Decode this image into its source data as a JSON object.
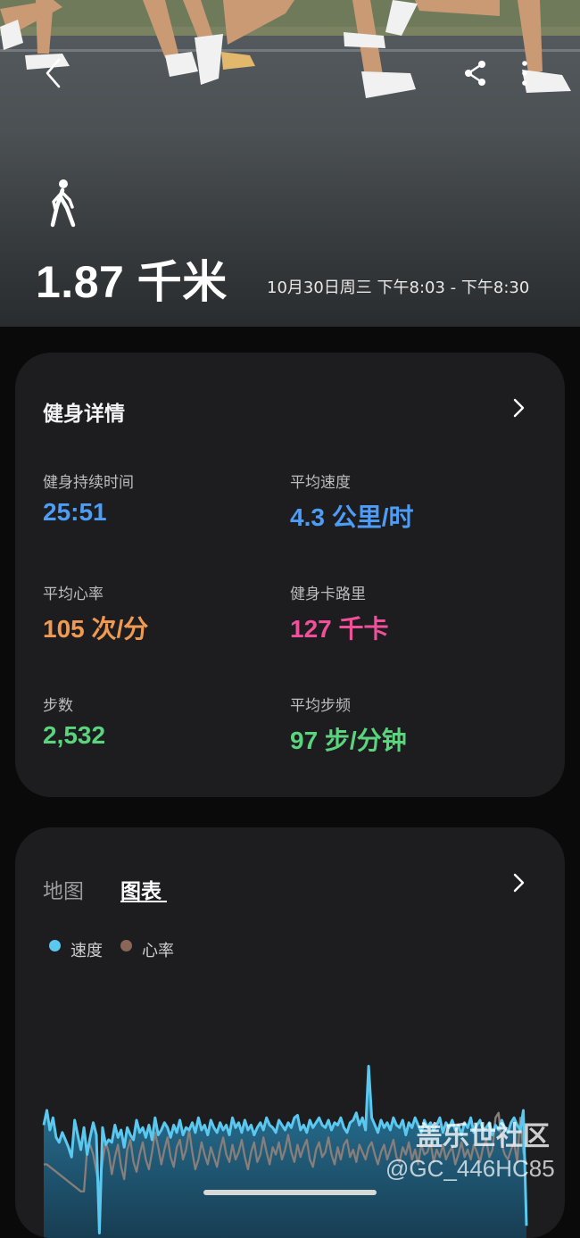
{
  "header": {
    "distance": "1.87 千米",
    "date_range": "10月30日周三 下午8:03 - 下午8:30"
  },
  "details_card": {
    "title": "健身详情",
    "stats": [
      {
        "label": "健身持续时间",
        "value": "25:51",
        "color": "#4d9cf5"
      },
      {
        "label": "平均速度",
        "value": "4.3 公里/时",
        "color": "#4d9cf5"
      },
      {
        "label": "平均心率",
        "value": "105 次/分",
        "color": "#ef9a54"
      },
      {
        "label": "健身卡路里",
        "value": "127 千卡",
        "color": "#f0509a"
      },
      {
        "label": "步数",
        "value": "2,532",
        "color": "#5bd47e"
      },
      {
        "label": "平均步频",
        "value": "97 步/分钟",
        "color": "#5bd47e"
      }
    ]
  },
  "chart_card": {
    "tabs": [
      {
        "label": "地图",
        "active": false
      },
      {
        "label": "图表",
        "active": true
      }
    ],
    "legend": [
      {
        "label": "速度",
        "color": "#5bc8f0"
      },
      {
        "label": "心率",
        "color": "#8a6656"
      }
    ]
  },
  "chart_data": {
    "type": "line",
    "series": [
      {
        "name": "速度",
        "color": "#5bc8f0",
        "values": [
          4.6,
          5.2,
          4.4,
          4.9,
          4.1,
          3.9,
          4.3,
          4.0,
          3.7,
          3.3,
          4.8,
          4.2,
          3.6,
          4.5,
          3.4,
          4.1,
          4.7,
          4.2,
          0.2,
          4.5,
          3.8,
          4.0,
          3.9,
          4.6,
          4.1,
          4.4,
          3.7,
          4.5,
          4.2,
          4.0,
          4.8,
          4.3,
          4.5,
          4.1,
          4.6,
          4.0,
          4.9,
          4.2,
          4.4,
          4.7,
          4.5,
          4.1,
          4.6,
          4.3,
          4.8,
          4.2,
          4.5,
          4.4,
          4.7,
          4.3,
          4.9,
          4.4,
          4.6,
          4.2,
          4.8,
          4.5,
          4.3,
          4.7,
          4.4,
          4.6,
          4.2,
          4.9,
          4.5,
          4.7,
          4.3,
          4.8,
          4.4,
          4.6,
          4.2,
          4.5,
          4.7,
          4.4,
          4.9,
          4.6,
          4.5,
          4.3,
          4.8,
          4.6,
          4.4,
          4.7,
          4.5,
          4.9,
          5.0,
          4.4,
          4.6,
          4.3,
          4.8,
          4.5,
          4.7,
          4.9,
          4.6,
          4.5,
          4.8,
          4.4,
          4.7,
          4.6,
          4.9,
          4.5,
          4.3,
          4.7,
          4.8,
          5.1,
          4.6,
          4.9,
          4.4,
          7.0,
          4.9,
          4.6,
          4.3,
          4.8,
          4.5,
          4.7,
          4.4,
          4.9,
          4.6,
          4.5,
          4.8,
          4.2,
          4.7,
          4.5,
          4.9,
          4.6,
          4.3,
          4.8,
          4.5,
          4.7,
          4.4,
          4.6,
          4.9,
          4.3,
          4.7,
          4.5,
          4.8,
          4.4,
          4.6,
          4.2,
          4.7,
          4.5,
          4.9,
          4.3,
          4.6,
          4.8,
          4.4,
          4.5,
          4.7,
          4.2,
          4.6,
          4.4,
          4.8,
          4.5,
          4.3,
          4.7,
          4.9,
          4.6,
          4.4,
          5.2,
          0.5
        ]
      },
      {
        "name": "心率",
        "color": "#8a6656",
        "values": [
          3.0,
          3.0,
          2.9,
          2.8,
          2.7,
          2.6,
          2.5,
          2.4,
          2.3,
          2.2,
          2.1,
          2.0,
          1.9,
          1.9,
          3.6,
          3.8,
          3.4,
          2.7,
          2.0,
          3.1,
          3.9,
          3.5,
          2.6,
          3.3,
          3.8,
          2.9,
          2.4,
          3.6,
          4.0,
          3.1,
          2.7,
          3.4,
          3.9,
          3.2,
          2.8,
          3.5,
          4.3,
          3.7,
          3.0,
          3.6,
          4.1,
          3.3,
          2.9,
          3.7,
          4.0,
          3.2,
          3.6,
          4.4,
          3.5,
          2.8,
          3.2,
          3.9,
          3.4,
          3.0,
          3.7,
          3.3,
          2.9,
          3.6,
          4.1,
          3.4,
          3.1,
          3.8,
          3.2,
          3.5,
          4.0,
          3.3,
          2.8,
          3.5,
          3.9,
          3.1,
          3.4,
          4.1,
          3.5,
          3.0,
          3.7,
          3.4,
          3.9,
          3.2,
          3.6,
          4.2,
          3.5,
          3.1,
          3.8,
          3.3,
          3.7,
          4.0,
          3.2,
          2.9,
          3.6,
          3.9,
          3.3,
          3.5,
          4.1,
          3.4,
          3.0,
          3.7,
          3.2,
          3.8,
          4.0,
          3.3,
          3.6,
          3.1,
          3.8,
          3.5,
          3.2,
          3.7,
          3.9,
          3.4,
          3.0,
          3.5,
          3.8,
          3.2,
          3.6,
          4.0,
          3.3,
          3.1,
          3.7,
          3.4,
          3.9,
          3.2,
          3.6,
          3.0,
          3.8,
          3.4,
          3.5,
          3.9,
          3.1,
          3.6,
          3.3,
          3.8,
          3.2,
          3.5,
          3.7,
          3.0,
          3.4,
          3.9,
          3.3,
          3.6,
          3.2,
          3.8,
          3.5,
          3.1,
          3.7,
          4.0,
          3.3,
          3.6,
          4.9,
          5.1,
          3.8,
          3.4,
          3.2,
          3.6,
          3.9,
          3.1,
          4.9,
          3.5,
          3.0
        ]
      }
    ]
  },
  "watermark": {
    "main": "盖乐世社区",
    "sub": "@GC_446HC85"
  }
}
